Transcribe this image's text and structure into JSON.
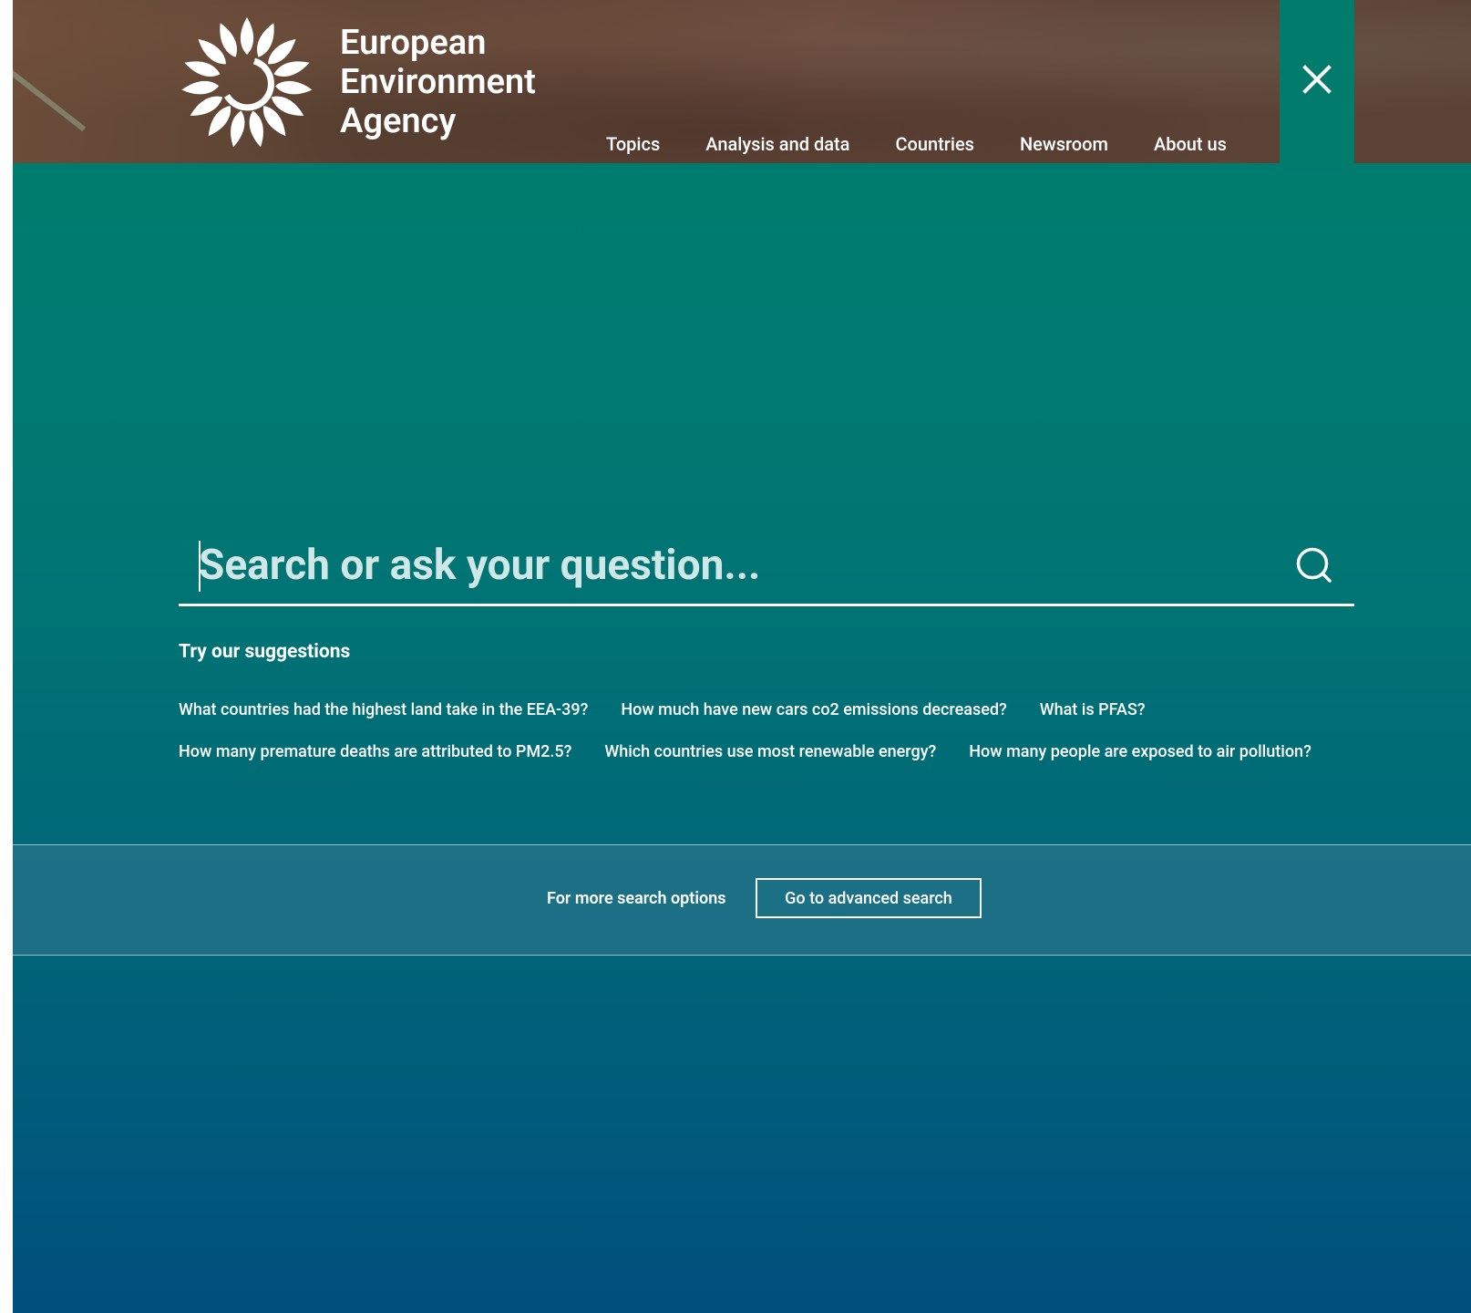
{
  "brand": {
    "line1": "European",
    "line2": "Environment",
    "line3": "Agency",
    "logo_icon": "eea-sunflower-logo"
  },
  "nav": {
    "items": [
      {
        "label": "Topics"
      },
      {
        "label": "Analysis and data"
      },
      {
        "label": "Countries"
      },
      {
        "label": "Newsroom"
      },
      {
        "label": "About us"
      }
    ]
  },
  "close": {
    "icon": "close-icon"
  },
  "search": {
    "placeholder": "Search or ask your question...",
    "value": "",
    "icon": "search-icon"
  },
  "suggestions": {
    "title": "Try our suggestions",
    "row1": [
      "What countries had the highest land take in the EEA-39?",
      "How much have new cars co2 emissions decreased?",
      "What is PFAS?"
    ],
    "row2": [
      "How many premature deaths are attributed to PM2.5?",
      "Which countries use most renewable energy?",
      "How many people are exposed to air pollution?"
    ]
  },
  "advanced": {
    "label": "For more search options",
    "button": "Go to advanced search"
  },
  "colors": {
    "teal": "#007b6c",
    "overlay_top": "#007c6f",
    "overlay_bottom": "#004f7d",
    "header_brown": "#5e4336"
  }
}
